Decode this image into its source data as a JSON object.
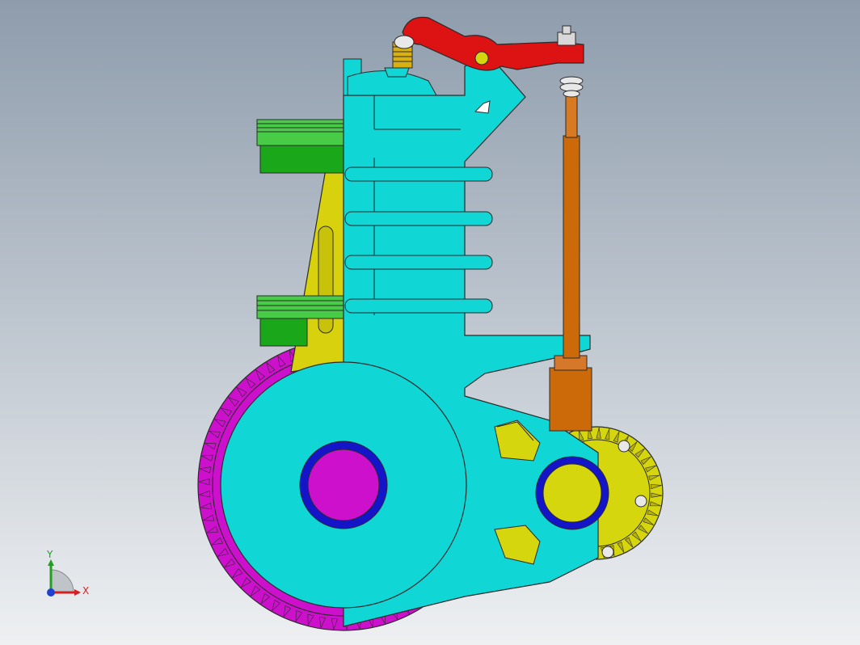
{
  "viewport": {
    "background_top": "#8e9cac",
    "background_bottom": "#eef0f2"
  },
  "model": {
    "parts": [
      "cylinder-body",
      "cooling-fins",
      "green-pistons",
      "yellow-connecting-rod",
      "magenta-flywheel",
      "yellow-cam-gear",
      "orange-push-rod",
      "red-rocker-arm",
      "valve-spring"
    ],
    "colors": {
      "body": "#10d6d6",
      "body_dark": "#0ab8b8",
      "piston": "#1aa81a",
      "piston_light": "#48cc48",
      "rod": "#d8d20e",
      "flywheel": "#cc10cc",
      "flywheel_light": "#e058e0",
      "bearing": "#1414c8",
      "crank_pin": "#cc10cc",
      "cam_pin": "#d6d60e",
      "push_rod": "#cc6a0a",
      "rocker": "#dd1212",
      "spring": "#d8b010",
      "outline": "#2a2a2a"
    }
  },
  "triad": {
    "x_label": "X",
    "y_label": "Y",
    "x_color": "#d42020",
    "y_color": "#20a020",
    "z_color": "#2040d0"
  }
}
